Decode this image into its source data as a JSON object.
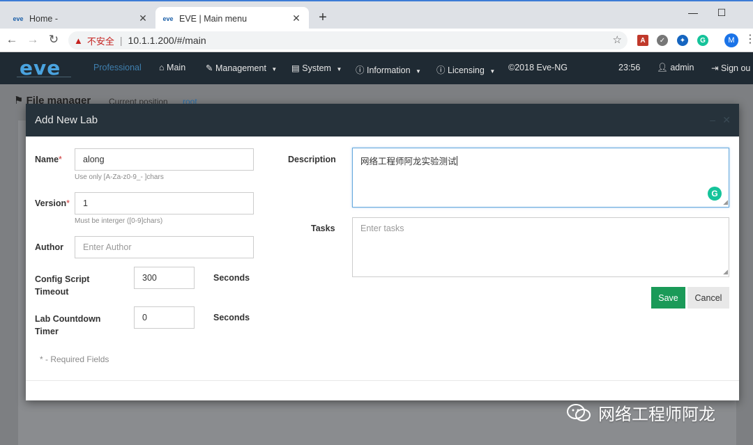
{
  "browser": {
    "tabs": [
      {
        "label": "Home -",
        "icon": "eve-favicon",
        "active": false
      },
      {
        "label": "EVE | Main menu",
        "icon": "eve-favicon",
        "active": true
      }
    ],
    "insecure_label": "不安全",
    "url": "10.1.1.200/#/main",
    "profile_initial": "M"
  },
  "navbar": {
    "logo": "eve",
    "items": [
      {
        "label": "Professional"
      },
      {
        "label": "Main",
        "icon": "home-icon"
      },
      {
        "label": "Management",
        "icon": "wrench-icon"
      },
      {
        "label": "System",
        "icon": "book-icon"
      },
      {
        "label": "Information",
        "icon": "info-icon"
      },
      {
        "label": "Licensing",
        "icon": "info-icon"
      },
      {
        "label": "©2018 Eve-NG"
      }
    ],
    "time": "23:56",
    "user": "admin",
    "signout": "Sign ou"
  },
  "background": {
    "title": "File manager",
    "position_label": "Current position",
    "position_value": "root"
  },
  "modal": {
    "title": "Add New Lab",
    "name": {
      "label": "Name",
      "value": "along",
      "hint": "Use only [A-Za-z0-9_- ]chars"
    },
    "version": {
      "label": "Version",
      "value": "1",
      "hint": "Must be interger ([0-9]chars)"
    },
    "author": {
      "label": "Author",
      "placeholder": "Enter Author"
    },
    "config_timeout": {
      "label_line1": "Config Script",
      "label_line2": "Timeout",
      "value": "300",
      "unit": "Seconds"
    },
    "countdown": {
      "label_line1": "Lab Countdown",
      "label_line2": "Timer",
      "value": "0",
      "unit": "Seconds"
    },
    "description": {
      "label": "Description",
      "value": "网络工程师阿龙实验测试"
    },
    "tasks": {
      "label": "Tasks",
      "placeholder": "Enter tasks"
    },
    "save_label": "Save",
    "cancel_label": "Cancel",
    "required_note": "* - Required Fields"
  },
  "watermark": "网络工程师阿龙"
}
